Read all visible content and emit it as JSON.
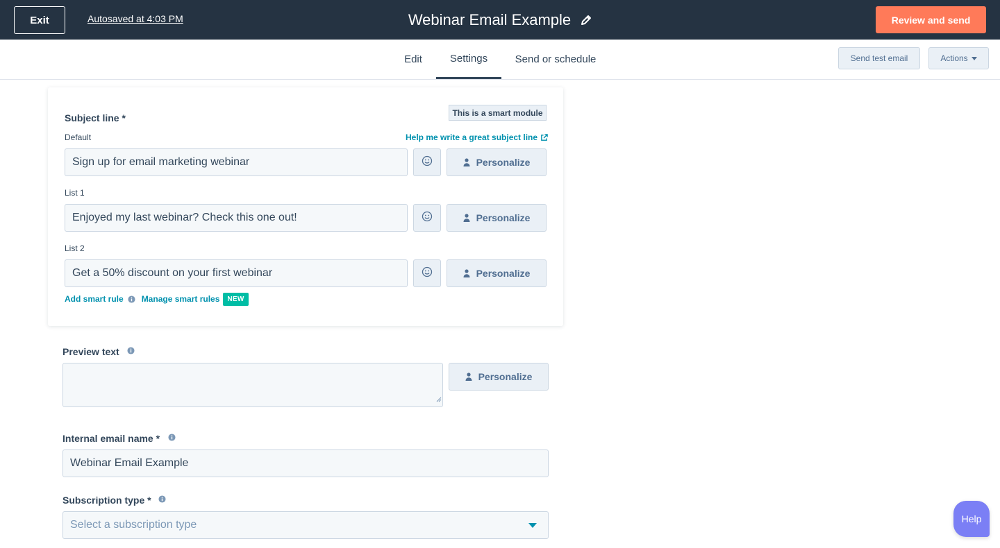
{
  "topbar": {
    "exit_label": "Exit",
    "autosave_text": "Autosaved at 4:03 PM",
    "title": "Webinar Email Example",
    "review_label": "Review and send"
  },
  "tabs": [
    {
      "label": "Edit",
      "active": false
    },
    {
      "label": "Settings",
      "active": true
    },
    {
      "label": "Send or schedule",
      "active": false
    }
  ],
  "toolbar": {
    "send_test_label": "Send test email",
    "actions_label": "Actions"
  },
  "smart_module": {
    "badge": "This is a smart module",
    "subject_label": "Subject line *",
    "help_link": "Help me write a great subject line",
    "personalize_label": "Personalize",
    "rows": [
      {
        "label": "Default",
        "value": "Sign up for email marketing webinar"
      },
      {
        "label": "List 1",
        "value": "Enjoyed my last webinar? Check this one out!"
      },
      {
        "label": "List 2",
        "value": "Get a 50% discount on your first webinar"
      }
    ],
    "add_rule": "Add smart rule",
    "manage_rules": "Manage smart rules",
    "new_badge": "NEW"
  },
  "preview": {
    "label": "Preview text",
    "value": "",
    "personalize_label": "Personalize"
  },
  "internal_name": {
    "label": "Internal email name *",
    "value": "Webinar Email Example"
  },
  "subscription": {
    "label": "Subscription type *",
    "placeholder": "Select a subscription type"
  },
  "help_fab": "Help",
  "colors": {
    "topbar": "#253342",
    "accent_orange": "#ff7a59",
    "link_teal": "#0091ae",
    "new_badge": "#00bda5",
    "help_purple": "#7b7ff5"
  }
}
